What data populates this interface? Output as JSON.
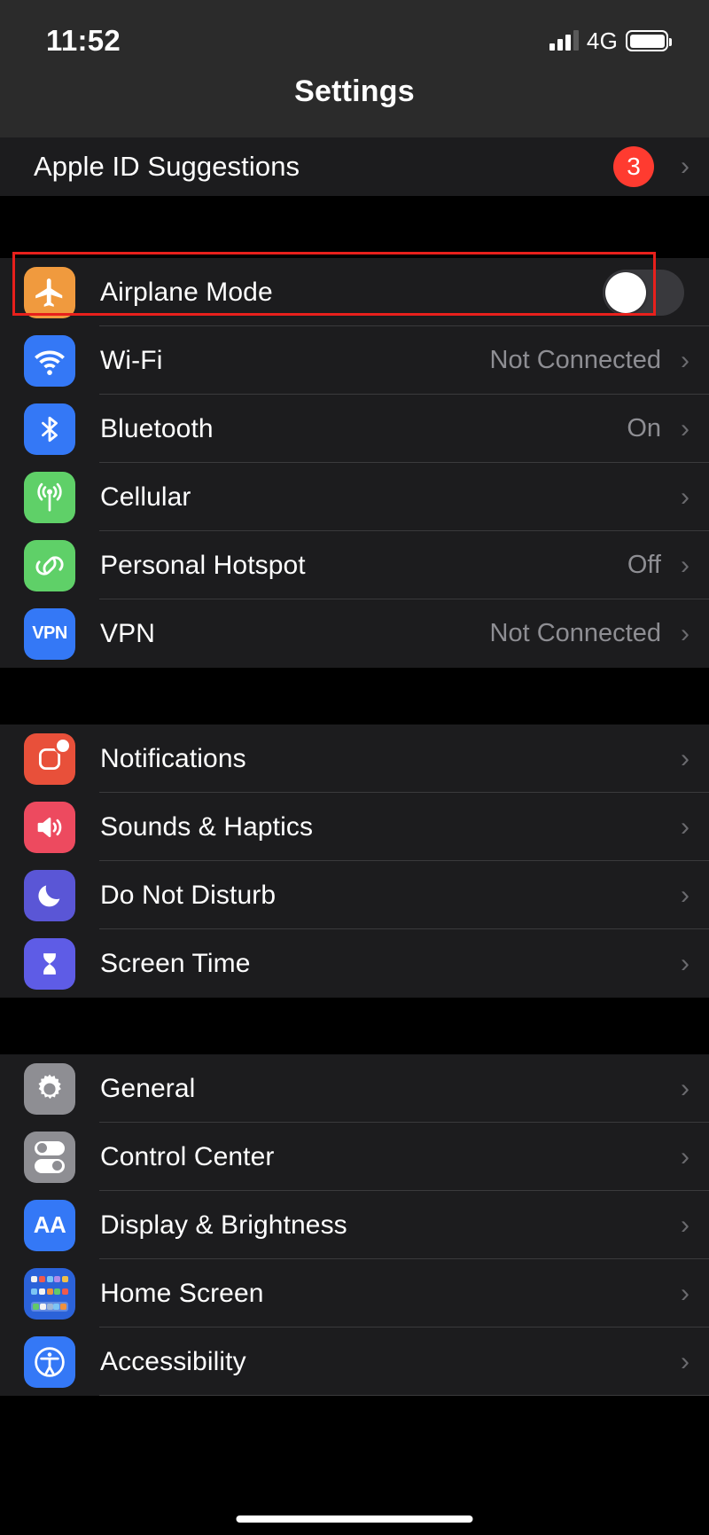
{
  "status_bar": {
    "time": "11:52",
    "network": "4G",
    "signal_bars_filled": 3,
    "signal_bars_total": 4,
    "battery_level": 100
  },
  "nav": {
    "title": "Settings"
  },
  "top_row": {
    "label": "Apple ID Suggestions",
    "badge": "3",
    "chevron": "›"
  },
  "groups": [
    {
      "id": "connectivity",
      "rows": [
        {
          "id": "airplane-mode",
          "label": "Airplane Mode",
          "value": "",
          "control": "toggle",
          "toggle_state": "off",
          "icon": "airplane-icon",
          "icon_color": "#f09a3e",
          "chevron": ""
        },
        {
          "id": "wifi",
          "label": "Wi-Fi",
          "value": "Not Connected",
          "control": "chevron",
          "icon": "wifi-icon",
          "icon_color": "#3478f6",
          "chevron": "›"
        },
        {
          "id": "bluetooth",
          "label": "Bluetooth",
          "value": "On",
          "control": "chevron",
          "icon": "bluetooth-icon",
          "icon_color": "#3478f6",
          "chevron": "›"
        },
        {
          "id": "cellular",
          "label": "Cellular",
          "value": "",
          "control": "chevron",
          "icon": "cellular-antenna-icon",
          "icon_color": "#5fd068",
          "chevron": "›"
        },
        {
          "id": "personal-hotspot",
          "label": "Personal Hotspot",
          "value": "Off",
          "control": "chevron",
          "icon": "hotspot-link-icon",
          "icon_color": "#5fd068",
          "chevron": "›"
        },
        {
          "id": "vpn",
          "label": "VPN",
          "value": "Not Connected",
          "control": "chevron",
          "icon": "vpn-icon",
          "icon_color": "#3478f6",
          "icon_text": "VPN",
          "chevron": "›"
        }
      ]
    },
    {
      "id": "alerts",
      "rows": [
        {
          "id": "notifications",
          "label": "Notifications",
          "value": "",
          "control": "chevron",
          "icon": "notifications-bell-icon",
          "icon_color": "#e8503a",
          "chevron": "›"
        },
        {
          "id": "sounds-haptics",
          "label": "Sounds & Haptics",
          "value": "",
          "control": "chevron",
          "icon": "speaker-icon",
          "icon_color": "#ed4a5f",
          "chevron": "›"
        },
        {
          "id": "do-not-disturb",
          "label": "Do Not Disturb",
          "value": "",
          "control": "chevron",
          "icon": "moon-icon",
          "icon_color": "#5a56d6",
          "chevron": "›"
        },
        {
          "id": "screen-time",
          "label": "Screen Time",
          "value": "",
          "control": "chevron",
          "icon": "hourglass-icon",
          "icon_color": "#5e5ce6",
          "chevron": "›"
        }
      ]
    },
    {
      "id": "system",
      "rows": [
        {
          "id": "general",
          "label": "General",
          "value": "",
          "control": "chevron",
          "icon": "gear-icon",
          "icon_color": "#8e8e93",
          "chevron": "›"
        },
        {
          "id": "control-center",
          "label": "Control Center",
          "value": "",
          "control": "chevron",
          "icon": "control-center-icon",
          "icon_color": "#8e8e93",
          "chevron": "›"
        },
        {
          "id": "display-brightness",
          "label": "Display & Brightness",
          "value": "",
          "control": "chevron",
          "icon": "text-size-aa-icon",
          "icon_color": "#3478f6",
          "icon_text": "AA",
          "chevron": "›"
        },
        {
          "id": "home-screen",
          "label": "Home Screen",
          "value": "",
          "control": "chevron",
          "icon": "home-screen-grid-icon",
          "icon_color": "#2b62d9",
          "chevron": "›"
        },
        {
          "id": "accessibility",
          "label": "Accessibility",
          "value": "",
          "control": "chevron",
          "icon": "accessibility-icon",
          "icon_color": "#3478f6",
          "chevron": "›"
        }
      ]
    }
  ],
  "annotation": {
    "target": "airplane-mode",
    "color": "#e8201c"
  }
}
